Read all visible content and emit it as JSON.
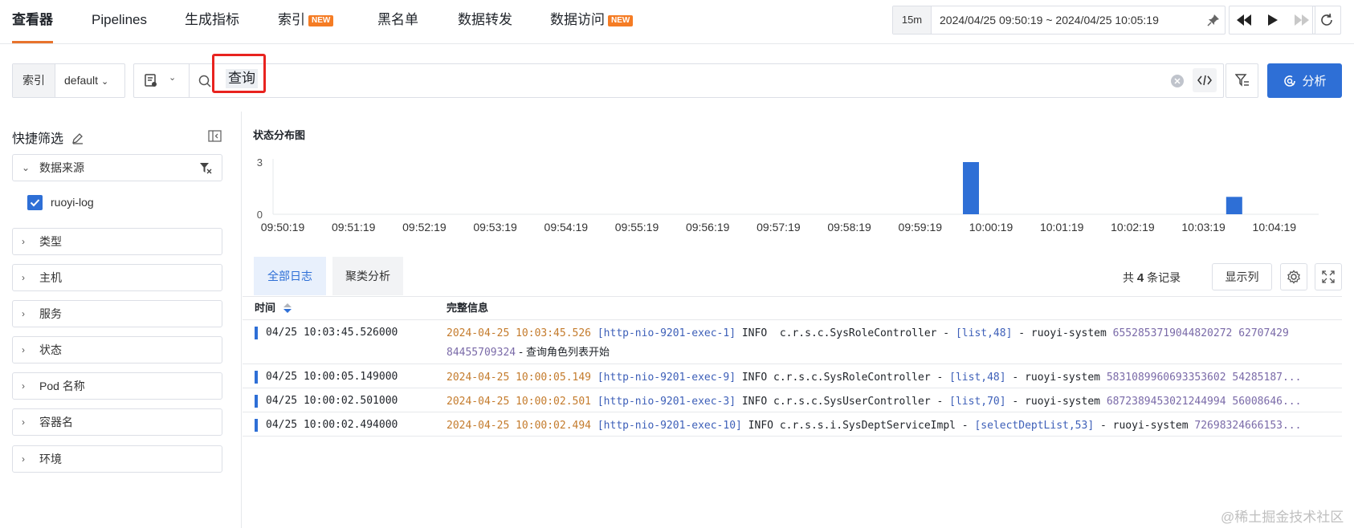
{
  "nav": {
    "tabs": [
      {
        "label": "查看器",
        "active": true
      },
      {
        "label": "Pipelines"
      },
      {
        "label": "生成指标"
      },
      {
        "label": "索引",
        "badge": "NEW"
      },
      {
        "label": "黑名单"
      },
      {
        "label": "数据转发"
      },
      {
        "label": "数据访问",
        "badge": "NEW"
      }
    ]
  },
  "time": {
    "quick": "15m",
    "range": "2024/04/25 09:50:19 ~ 2024/04/25 10:05:19"
  },
  "query": {
    "index_label": "索引",
    "index_value": "default",
    "text": "查询"
  },
  "analyze_label": "分析",
  "sidebar": {
    "title": "快捷筛选",
    "source_group": "数据来源",
    "source_item": "ruoyi-log",
    "groups": [
      "类型",
      "主机",
      "服务",
      "状态",
      "Pod 名称",
      "容器名",
      "环境"
    ]
  },
  "chart_data": {
    "type": "bar",
    "title": "状态分布图",
    "categories": [
      "09:50:19",
      "09:51:19",
      "09:52:19",
      "09:53:19",
      "09:54:19",
      "09:55:19",
      "09:56:19",
      "09:57:19",
      "09:58:19",
      "09:59:19",
      "10:00:19",
      "10:01:19",
      "10:02:19",
      "10:03:19",
      "10:04:19"
    ],
    "bars": [
      {
        "x": "10:00:02",
        "value": 3
      },
      {
        "x": "10:03:45",
        "value": 1
      }
    ],
    "ylim": [
      0,
      3
    ],
    "yticks": [
      "3",
      "0"
    ],
    "color": "#2e6fd6"
  },
  "logs": {
    "tabs": [
      "全部日志",
      "聚类分析"
    ],
    "total_prefix": "共",
    "total_count": "4",
    "total_suffix": "条记录",
    "columns_button": "显示列",
    "col_time": "时间",
    "col_message": "完整信息",
    "rows": [
      {
        "time": "04/25 10:03:45.526000",
        "ts": "2024-04-25 10:03:45.526",
        "thread": "[http-nio-9201-exec-1]",
        "mid": " INFO  c.r.s.c.SysRoleController - ",
        "bracket": "[list,48]",
        "service": " - ruoyi-system ",
        "trace": "6552853719044820272 62707429 84455709324",
        "tail": " - 查询角色列表开始"
      },
      {
        "time": "04/25 10:00:05.149000",
        "ts": "2024-04-25 10:00:05.149",
        "thread": "[http-nio-9201-exec-9]",
        "mid": " INFO c.r.s.c.SysRoleController - ",
        "bracket": "[list,48]",
        "service": " - ruoyi-system ",
        "trace": "5831089960693353602 54285187...",
        "tail": ""
      },
      {
        "time": "04/25 10:00:02.501000",
        "ts": "2024-04-25 10:00:02.501",
        "thread": "[http-nio-9201-exec-3]",
        "mid": " INFO c.r.s.c.SysUserController - ",
        "bracket": "[list,70]",
        "service": " - ruoyi-system ",
        "trace": "6872389453021244994 56008646...",
        "tail": ""
      },
      {
        "time": "04/25 10:00:02.494000",
        "ts": "2024-04-25 10:00:02.494",
        "thread": "[http-nio-9201-exec-10]",
        "mid": " INFO c.r.s.s.i.SysDeptServiceImpl - ",
        "bracket": "[selectDeptList,53]",
        "service": " - ruoyi-system ",
        "trace": "72698324666153...",
        "tail": ""
      }
    ]
  },
  "watermark": "@稀土掘金技术社区"
}
